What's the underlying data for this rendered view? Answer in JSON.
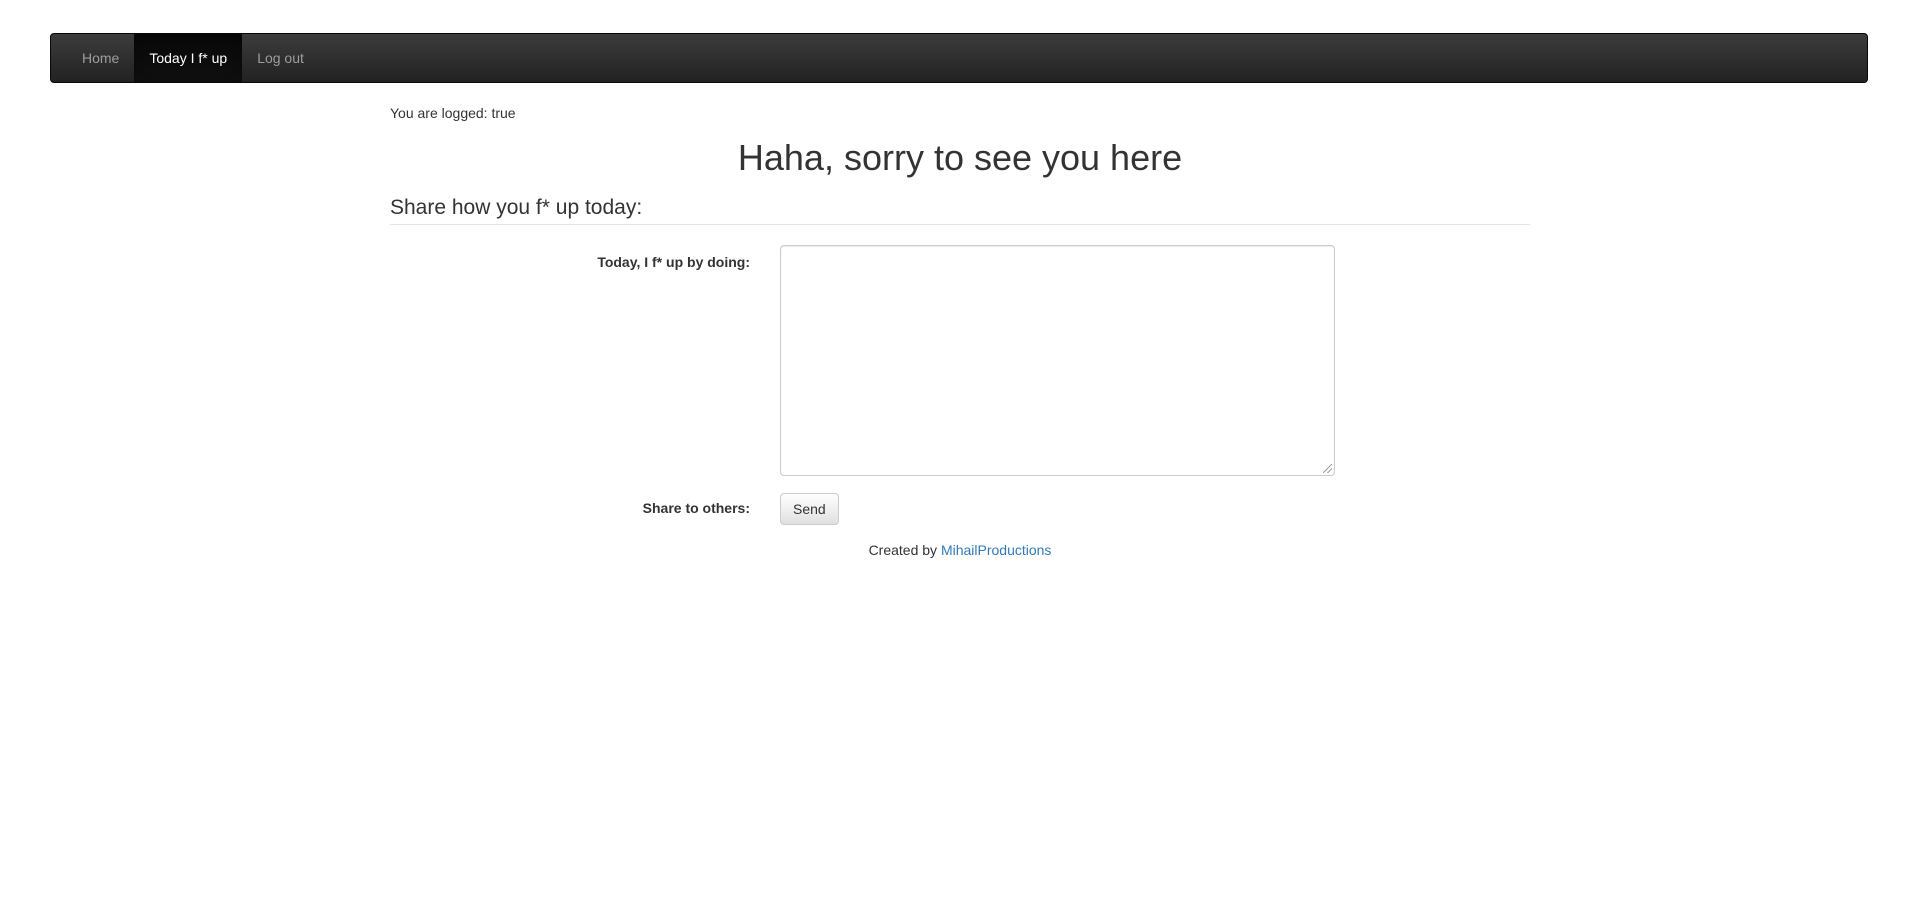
{
  "navbar": {
    "items": [
      {
        "label": "Home",
        "active": false
      },
      {
        "label": "Today I f* up",
        "active": true
      },
      {
        "label": "Log out",
        "active": false
      }
    ]
  },
  "status": {
    "logged_text": "You are logged: true"
  },
  "page": {
    "heading": "Haha, sorry to see you here",
    "section_heading": "Share how you f* up today:"
  },
  "form": {
    "doing_label": "Today, I f* up by doing:",
    "doing_value": "",
    "share_label": "Share to others:",
    "send_label": "Send"
  },
  "footer": {
    "prefix": "Created by",
    "author_link": "MihailProductions",
    "link_color": "#337ab7"
  }
}
